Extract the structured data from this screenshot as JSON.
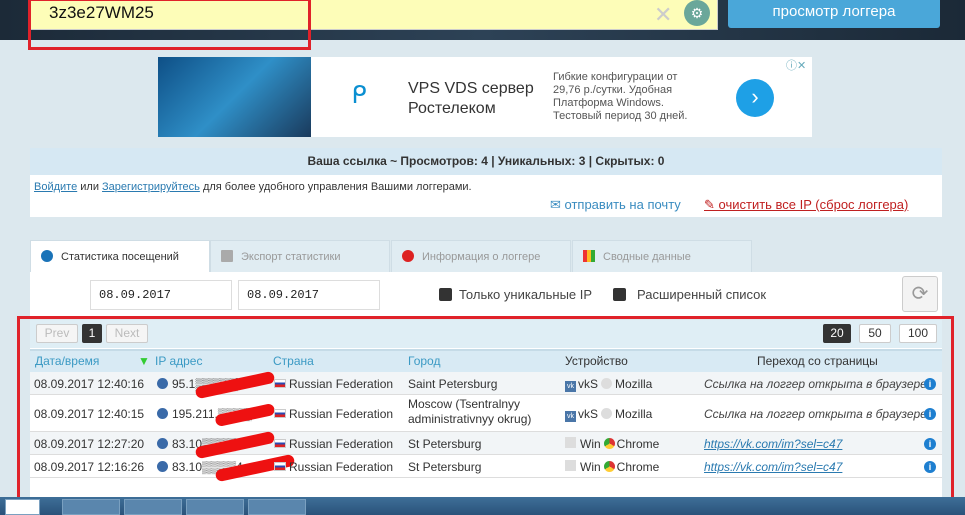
{
  "search": {
    "value": "3z3e27WM25",
    "view_button": "просмотр логгера"
  },
  "ad": {
    "title": "VPS VDS сервер Ростелеком",
    "description": "Гибкие конфигурации от 29,76 р./сутки. Удобная Платформа Windows. Тестовый период 30 дней.",
    "info": "ⓘ✕"
  },
  "stats": {
    "text": "Ваша ссылка ~ Просмотров: 4 | Уникальных: 3 | Скрытых: 0"
  },
  "notice": {
    "login": "Войдите",
    "or": " или ",
    "register": "Зарегистрируйтесь",
    "rest": " для более удобного управления Вашими логгерами.",
    "send_mail": "отправить на почту",
    "clear_ip": "очистить все IP (сброс логгера)"
  },
  "tabs": [
    {
      "label": "Статистика посещений",
      "active": true,
      "color": "#1a73b8"
    },
    {
      "label": "Экспорт статистики",
      "color": "#aaaaaa"
    },
    {
      "label": "Информация о логгере",
      "color": "#d22"
    },
    {
      "label": "Сводные данные",
      "color": "#e8a020"
    }
  ],
  "filters": {
    "date_from": "08.09.2017",
    "date_to": "08.09.2017",
    "unique_ip": "Только уникальные IP",
    "extended": "Расширенный список"
  },
  "pager": {
    "prev": "Prev",
    "page": "1",
    "next": "Next",
    "sizes": [
      "20",
      "50",
      "100"
    ],
    "selected_size": "20"
  },
  "table": {
    "headers": [
      "Дата/время",
      "IP адрес",
      "Страна",
      "Город",
      "Устройство",
      "Переход со страницы"
    ],
    "rows": [
      {
        "datetime": "08.09.2017 12:40:16",
        "ip": "95.1▒▒▒▒▒6",
        "country": "Russian Federation",
        "city": "Saint Petersburg",
        "os": "vkS",
        "browser": "Mozilla",
        "referrer": "Ссылка на логгер открыта в браузере",
        "ref_link": false
      },
      {
        "datetime": "08.09.2017 12:40:15",
        "ip": "195.211.▒▒▒▒",
        "country": "Russian Federation",
        "city": "Moscow (Tsentralnyy administrativnyy okrug)",
        "os": "vkS",
        "browser": "Mozilla",
        "referrer": "Ссылка на логгер открыта в браузере",
        "ref_link": false
      },
      {
        "datetime": "08.09.2017 12:27:20",
        "ip": "83.10▒▒▒▒",
        "country": "Russian Federation",
        "city": "St Petersburg",
        "os": "Win",
        "browser": "Chrome",
        "referrer": "https://vk.com/im?sel=c47",
        "ref_link": true
      },
      {
        "datetime": "08.09.2017 12:16:26",
        "ip": "83.10▒▒▒▒4",
        "country": "Russian Federation",
        "city": "St Petersburg",
        "os": "Win",
        "browser": "Chrome",
        "referrer": "https://vk.com/im?sel=c47",
        "ref_link": true
      }
    ]
  },
  "colors": {
    "highlight_box": "#e0222a",
    "accent": "#4aa7d9",
    "link": "#2a7ab0"
  }
}
